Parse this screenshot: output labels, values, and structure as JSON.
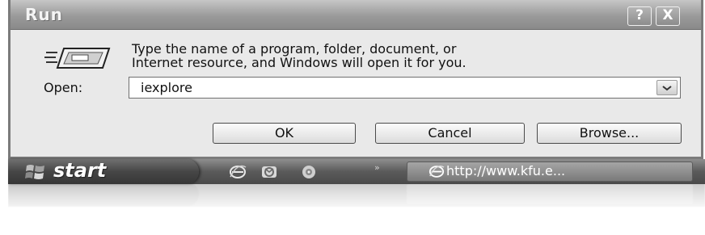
{
  "window": {
    "title": "Run",
    "help_button": "?",
    "close_button": "X",
    "description_lines": [
      "Type the name of a program, folder, document, or",
      "Internet resource, and Windows will open it for you."
    ],
    "open_label": "Open:",
    "open_value": "iexplore",
    "buttons": {
      "ok": "OK",
      "cancel": "Cancel",
      "browse": "Browse..."
    }
  },
  "taskbar": {
    "start_label": "start",
    "quick_launch_icons": [
      "internet-explorer-icon",
      "outlook-express-icon",
      "media-player-icon"
    ],
    "overflow_chevron": "»",
    "task_item_label": "http://www.kfu.e..."
  },
  "colors": {
    "window_bg": "#e9e9e9",
    "titlebar": "#9a9a9a",
    "taskbar": "#5a5a5a",
    "text": "#111111"
  }
}
